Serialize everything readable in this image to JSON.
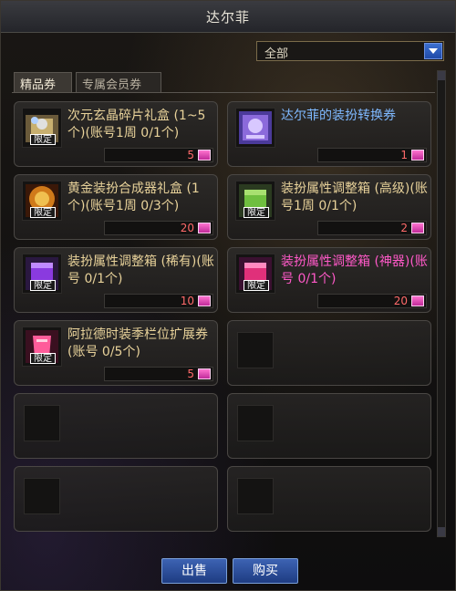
{
  "window": {
    "title": "达尔菲"
  },
  "filter": {
    "selected": "全部"
  },
  "tabs": [
    {
      "label": "精品券"
    },
    {
      "label": "专属会员券"
    }
  ],
  "items": [
    {
      "name": "次元玄晶碎片礼盒 (1~5个)(账号1周 0/1个)",
      "price": "5",
      "limited": "限定",
      "color": "#e8d29a",
      "icon": "gift-box-icon"
    },
    {
      "name": "达尔菲的装扮转换券",
      "price": "1",
      "limited": "",
      "color": "#7fb9ff",
      "icon": "ticket-icon"
    },
    {
      "name": "黄金装扮合成器礼盒 (1个)(账号1周 0/3个)",
      "price": "20",
      "limited": "限定",
      "color": "#e8d29a",
      "icon": "gold-box-icon"
    },
    {
      "name": "装扮属性调整箱 (高级)(账号1周 0/1个)",
      "price": "2",
      "limited": "限定",
      "color": "#e8d29a",
      "icon": "green-box-icon"
    },
    {
      "name": "装扮属性调整箱 (稀有)(账号 0/1个)",
      "price": "10",
      "limited": "限定",
      "color": "#e8d29a",
      "icon": "purple-box-icon"
    },
    {
      "name": "装扮属性调整箱 (神器)(账号 0/1个)",
      "price": "20",
      "limited": "限定",
      "color": "#ff59c8",
      "icon": "pink-box-icon"
    },
    {
      "name": "阿拉德时装季栏位扩展券(账号 0/5个)",
      "price": "5",
      "limited": "限定",
      "color": "#e8d29a",
      "icon": "scroll-ticket-icon"
    }
  ],
  "buttons": {
    "sell": "出售",
    "buy": "购买"
  },
  "colors": {
    "price": "#ff6a6a",
    "button": "#2a4fa0",
    "coin": "#e040b0"
  }
}
